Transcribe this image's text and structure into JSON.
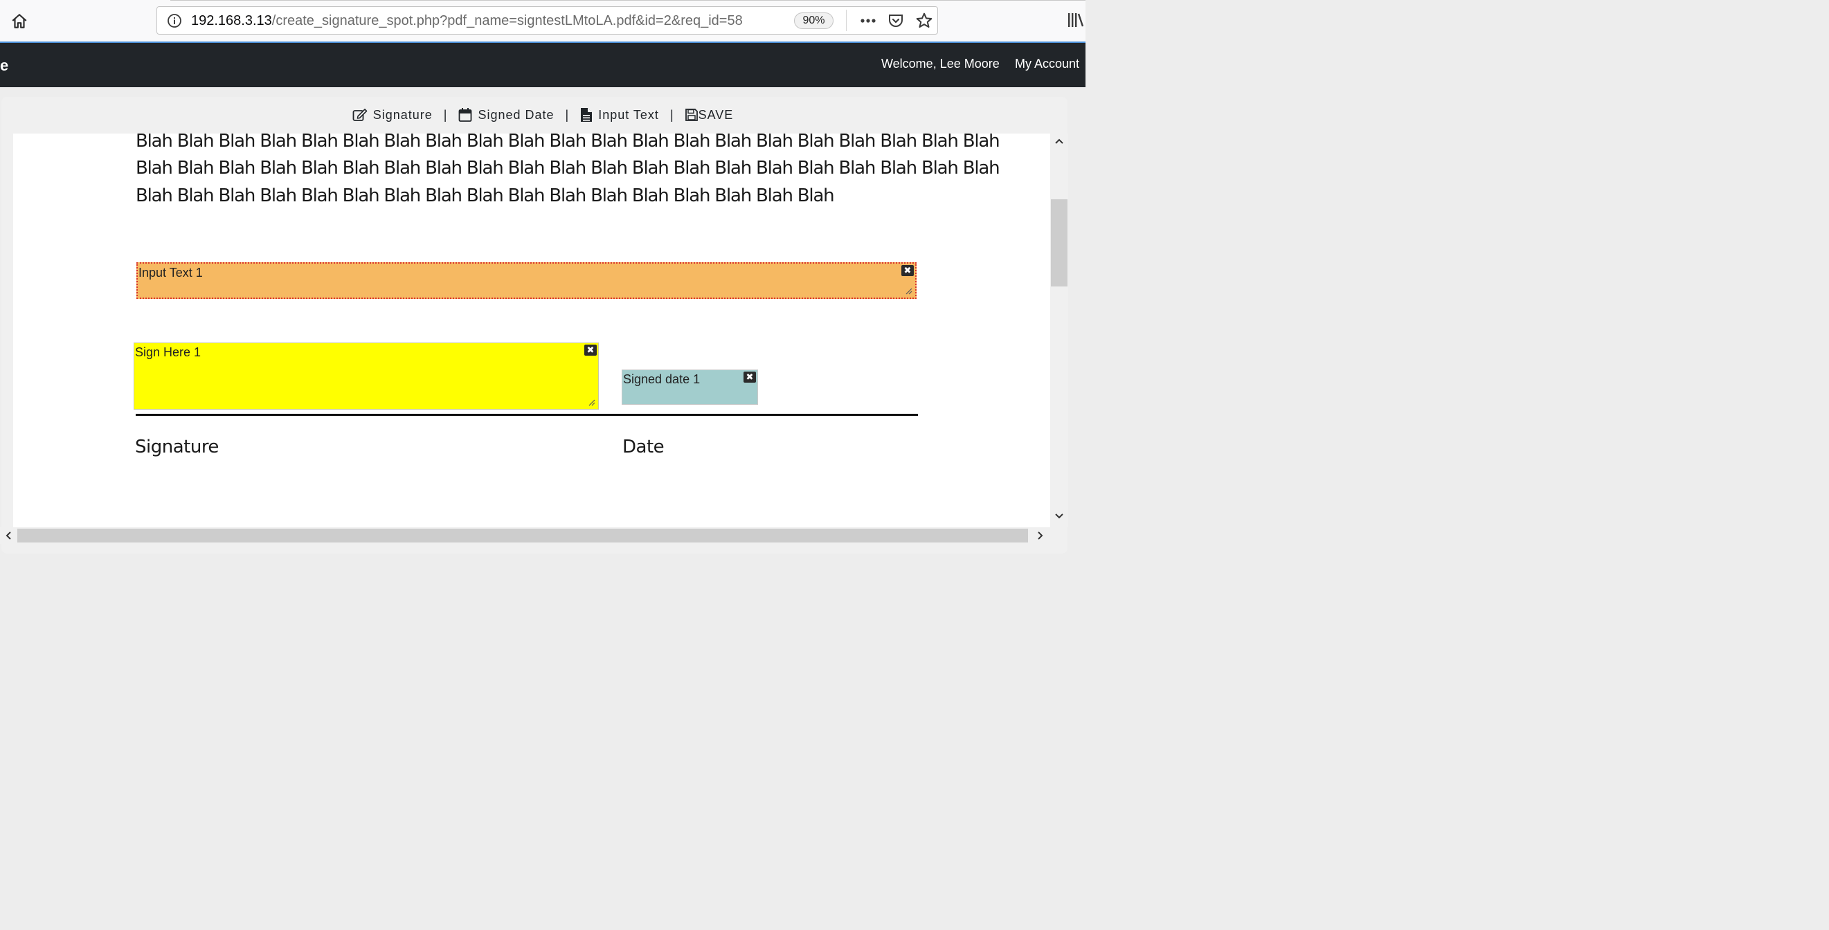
{
  "browser": {
    "url_host": "192.168.3.13",
    "url_path": "/create_signature_spot.php?pdf_name=signtestLMtoLA.pdf&id=2&req_id=58",
    "zoom": "90%"
  },
  "navbar": {
    "brand_fragment": "e",
    "welcome": "Welcome, Lee Moore",
    "account_link": "My Account"
  },
  "toolbar": {
    "signature_label": "Signature",
    "signed_date_label": "Signed Date",
    "input_text_label": "Input Text",
    "save_label": "SAVE",
    "separator": "|"
  },
  "document": {
    "paragraph_lines": [
      "Blah Blah Blah Blah Blah Blah Blah Blah Blah Blah Blah Blah Blah Blah Blah Blah Blah Blah Blah Blah Blah",
      "Blah Blah Blah Blah Blah Blah Blah Blah Blah Blah Blah Blah Blah Blah Blah Blah Blah Blah Blah Blah Blah",
      "Blah Blah Blah Blah Blah Blah Blah Blah Blah Blah Blah Blah Blah Blah Blah Blah Blah"
    ],
    "signature_caption": "Signature",
    "date_caption": "Date"
  },
  "fields": {
    "input_text": {
      "label": "Input Text 1",
      "color": "#f6b962"
    },
    "signature": {
      "label": "Sign Here 1",
      "color": "#ffff00"
    },
    "signed_date": {
      "label": "Signed date 1",
      "color": "#a2cdcd"
    },
    "close_glyph": "✖"
  }
}
